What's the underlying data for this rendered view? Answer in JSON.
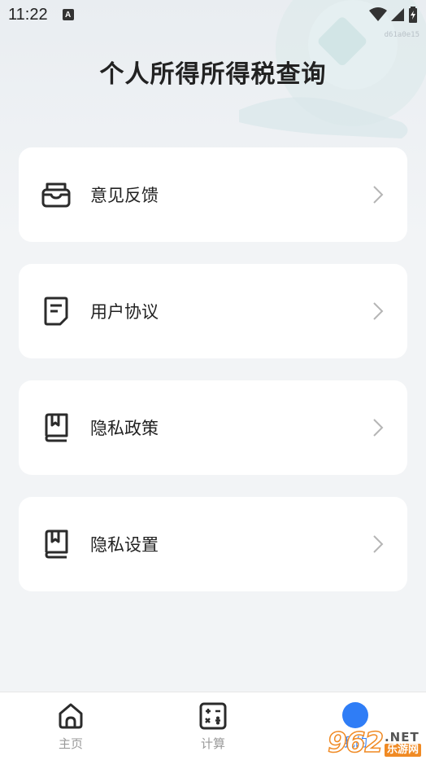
{
  "status_bar": {
    "time": "11:22",
    "notification_letter": "A",
    "debug_id": "d61a0e15"
  },
  "page": {
    "title": "个人所得所得税查询"
  },
  "menu": [
    {
      "label": "意见反馈",
      "icon": "feedback-inbox-icon"
    },
    {
      "label": "用户协议",
      "icon": "document-icon"
    },
    {
      "label": "隐私政策",
      "icon": "book-icon"
    },
    {
      "label": "隐私设置",
      "icon": "book-icon"
    }
  ],
  "tabbar": {
    "tabs": [
      {
        "label": "主页",
        "icon": "home-icon"
      },
      {
        "label": "计算",
        "icon": "calculator-icon"
      },
      {
        "label": "我的",
        "icon": "profile-icon",
        "active": true
      }
    ]
  },
  "watermark": {
    "number": "962",
    "suffix": ".NET",
    "site": "乐游网"
  },
  "colors": {
    "background": "#f2f4f6",
    "card": "#ffffff",
    "accent": "#2f7df6",
    "icon": "#2b2b2b",
    "tab_inactive": "#9a9a9a"
  }
}
